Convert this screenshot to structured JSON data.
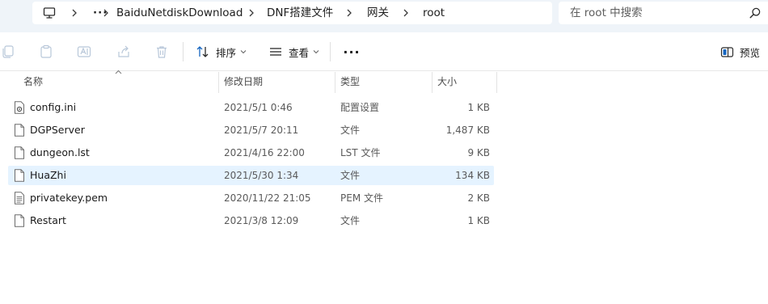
{
  "address_bar": {
    "breadcrumb": [
      "···",
      "BaiduNetdiskDownload",
      "DNF搭建文件",
      "网关",
      "root"
    ],
    "root_icon": "this-pc-icon",
    "separator_icon": "chevron-right-icon"
  },
  "search": {
    "placeholder": "在 root 中搜索",
    "icon": "search-icon"
  },
  "toolbar": {
    "icons": [
      "copy-icon",
      "paste-icon",
      "rename-icon",
      "share-icon",
      "delete-icon"
    ],
    "sort_label": "排序",
    "view_label": "查看",
    "more_label": "···",
    "preview_label": "预览"
  },
  "columns": {
    "name": "名称",
    "date": "修改日期",
    "type": "类型",
    "size": "大小"
  },
  "files": [
    {
      "name": "config.ini",
      "date": "2021/5/1 0:46",
      "type": "配置设置",
      "size": "1 KB",
      "icon": "settings-file-icon",
      "selected": false
    },
    {
      "name": "DGPServer",
      "date": "2021/5/7 20:11",
      "type": "文件",
      "size": "1,487 KB",
      "icon": "file-icon",
      "selected": false
    },
    {
      "name": "dungeon.lst",
      "date": "2021/4/16 22:00",
      "type": "LST 文件",
      "size": "9 KB",
      "icon": "file-icon",
      "selected": false
    },
    {
      "name": "HuaZhi",
      "date": "2021/5/30 1:34",
      "type": "文件",
      "size": "134 KB",
      "icon": "file-icon",
      "selected": true
    },
    {
      "name": "privatekey.pem",
      "date": "2020/11/22 21:05",
      "type": "PEM 文件",
      "size": "2 KB",
      "icon": "text-file-icon",
      "selected": false
    },
    {
      "name": "Restart",
      "date": "2021/3/8 12:09",
      "type": "文件",
      "size": "1 KB",
      "icon": "file-icon",
      "selected": false
    }
  ],
  "colors": {
    "address_bg": "#eff4f9",
    "selected_row": "#e5f3ff",
    "toolbar_divider": "#e0e0e0",
    "accent_blue": "#1565c0"
  }
}
